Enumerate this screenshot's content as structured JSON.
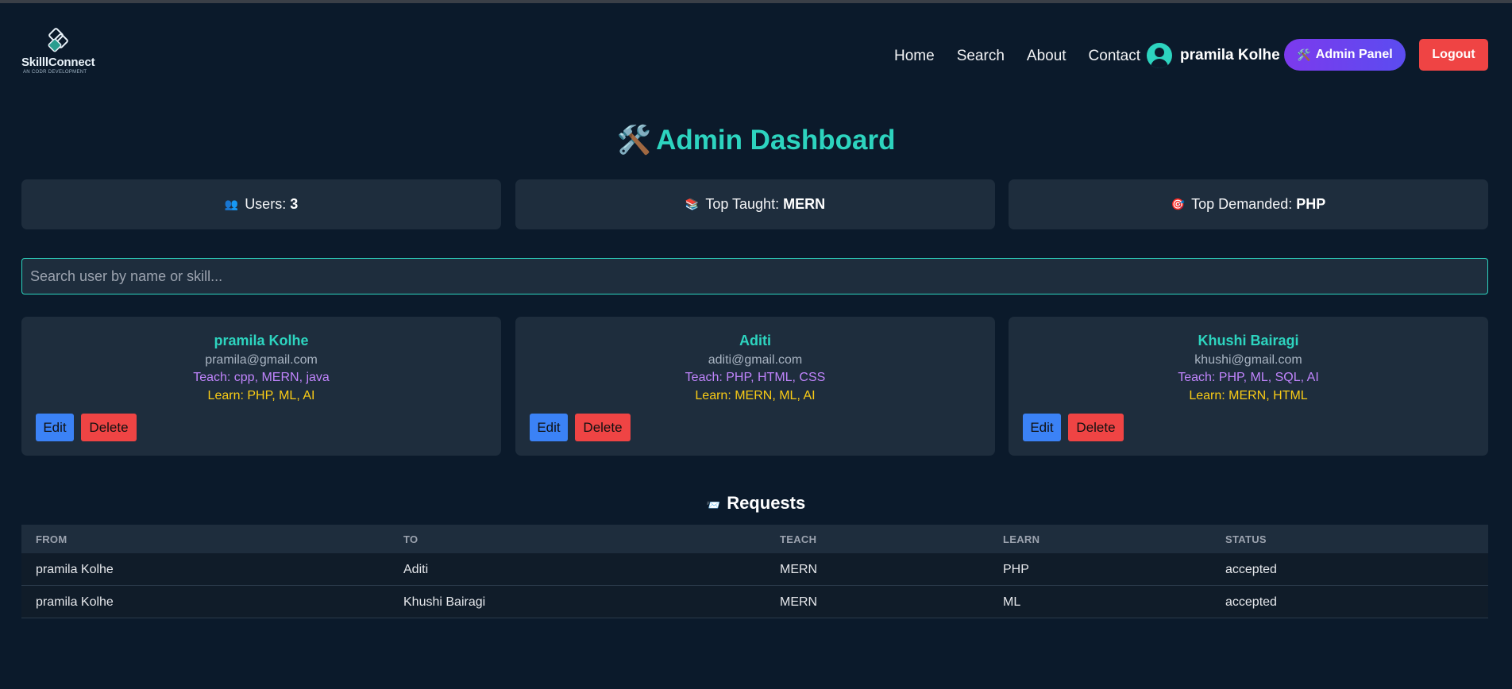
{
  "brand": {
    "name": "SkilllConnect",
    "tagline": "AN CODR DEVELOPMENT"
  },
  "nav": {
    "links": [
      "Home",
      "Search",
      "About",
      "Contact"
    ],
    "user_name": "pramila Kolhe",
    "admin_label": "Admin Panel",
    "logout_label": "Logout"
  },
  "page": {
    "title": "Admin Dashboard",
    "title_emoji": "🛠️"
  },
  "stats": [
    {
      "emoji": "👥",
      "label": "Users:",
      "value": "3"
    },
    {
      "emoji": "📚",
      "label": "Top Taught:",
      "value": "MERN"
    },
    {
      "emoji": "🎯",
      "label": "Top Demanded:",
      "value": "PHP"
    }
  ],
  "search": {
    "placeholder": "Search user by name or skill...",
    "value": ""
  },
  "users": [
    {
      "name": "pramila Kolhe",
      "email": "pramila@gmail.com",
      "teach": "Teach: cpp, MERN, java",
      "learn": "Learn: PHP, ML, AI"
    },
    {
      "name": "Aditi",
      "email": "aditi@gmail.com",
      "teach": "Teach: PHP, HTML, CSS",
      "learn": "Learn: MERN, ML, AI"
    },
    {
      "name": "Khushi Bairagi",
      "email": "khushi@gmail.com",
      "teach": "Teach: PHP, ML, SQL, AI",
      "learn": "Learn: MERN, HTML"
    }
  ],
  "card_buttons": {
    "edit": "Edit",
    "delete": "Delete"
  },
  "requests": {
    "title": "Requests",
    "emoji": "📨",
    "columns": [
      "FROM",
      "TO",
      "TEACH",
      "LEARN",
      "STATUS"
    ],
    "rows": [
      [
        "pramila Kolhe",
        "Aditi",
        "MERN",
        "PHP",
        "accepted"
      ],
      [
        "pramila Kolhe",
        "Khushi Bairagi",
        "MERN",
        "ML",
        "accepted"
      ]
    ]
  },
  "colors": {
    "accent": "#2dd4bf",
    "bg": "#0b1a2b",
    "panel": "#1e2d3d",
    "danger": "#ef4444",
    "primary": "#3b82f6",
    "purple": "#7c3aed",
    "teach": "#c084fc",
    "learn": "#facc15"
  }
}
